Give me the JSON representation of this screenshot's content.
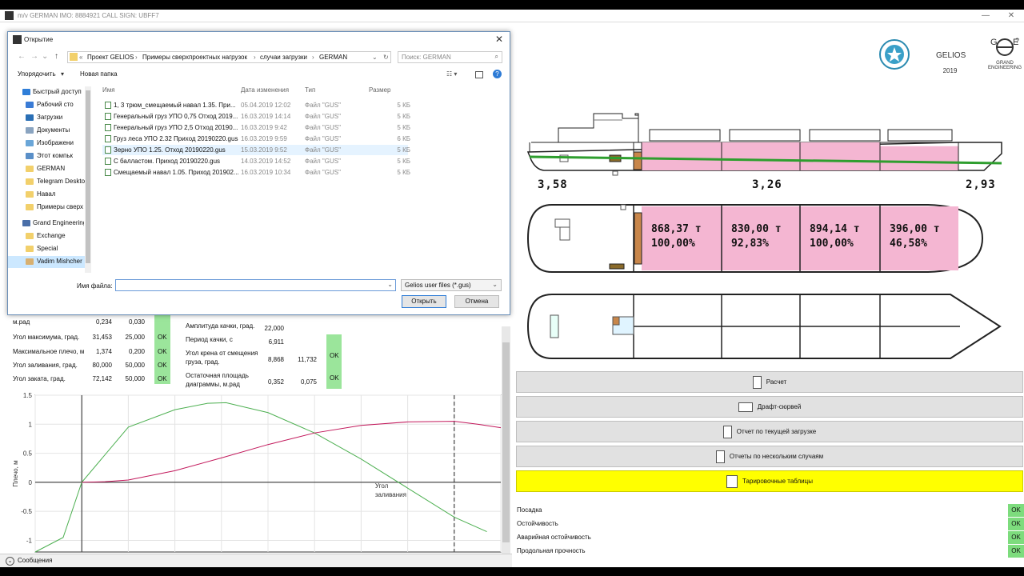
{
  "window": {
    "title": "m/v GERMAN IMO: 8884921 CALL SIGN: UBFF7",
    "help": "?"
  },
  "dialog": {
    "title": "Открытие",
    "breadcrumb": [
      "«",
      "Проект GELIOS",
      "Примеры сверхпроектных нагрузок",
      "случаи загрузки",
      "GERMAN"
    ],
    "search_placeholder": "Поиск: GERMAN",
    "organize": "Упорядочить",
    "new_folder": "Новая папка",
    "nav_items": [
      {
        "label": "Быстрый доступ",
        "top": true,
        "color": "#2f7ed8"
      },
      {
        "label": "Рабочий сто",
        "color": "#3a7bd5"
      },
      {
        "label": "Загрузки",
        "color": "#2a6fb5"
      },
      {
        "label": "Документы",
        "color": "#8aa4c0"
      },
      {
        "label": "Изображени",
        "color": "#6aa6d8"
      },
      {
        "label": "Этот компьк",
        "color": "#5a8fc8"
      },
      {
        "label": "GERMAN",
        "color": "#f2d06b"
      },
      {
        "label": "Telegram Deskto",
        "color": "#f2d06b"
      },
      {
        "label": "Навал",
        "color": "#f2d06b"
      },
      {
        "label": "Примеры сверх",
        "color": "#f2d06b"
      },
      {
        "label": "Grand Engineering",
        "top": true,
        "color": "#4a6fa8"
      },
      {
        "label": "Exchange",
        "color": "#f2d06b"
      },
      {
        "label": "Special",
        "color": "#f2d06b"
      },
      {
        "label": "Vadim Mishcher",
        "color": "#d8b070",
        "selected": true
      }
    ],
    "columns": {
      "name": "Имя",
      "date": "Дата изменения",
      "type": "Тип",
      "size": "Размер"
    },
    "files": [
      {
        "name": "1, 3 трюм_смещаемый навал 1.35. При...",
        "date": "05.04.2019 12:02",
        "type": "Файл \"GUS\"",
        "size": "5 КБ"
      },
      {
        "name": "Генеральный груз УПО 0,75 Отход 2019...",
        "date": "16.03.2019 14:14",
        "type": "Файл \"GUS\"",
        "size": "5 КБ"
      },
      {
        "name": "Генеральный груз УПО 2,5 Отход 20190...",
        "date": "16.03.2019 9:42",
        "type": "Файл \"GUS\"",
        "size": "5 КБ"
      },
      {
        "name": "Груз леса УПО 2.32 Приход 20190220.gus",
        "date": "16.03.2019 9:59",
        "type": "Файл \"GUS\"",
        "size": "6 КБ"
      },
      {
        "name": "Зерно УПО 1.25. Отход 20190220.gus",
        "date": "15.03.2019 9:52",
        "type": "Файл \"GUS\"",
        "size": "5 КБ"
      },
      {
        "name": "С балластом. Приход 20190220.gus",
        "date": "14.03.2019 14:52",
        "type": "Файл \"GUS\"",
        "size": "5 КБ"
      },
      {
        "name": "Смещаемый навал 1.05. Приход 201902...",
        "date": "16.03.2019 10:34",
        "type": "Файл \"GUS\"",
        "size": "5 КБ"
      }
    ],
    "filename_label": "Имя файла:",
    "filename_value": "",
    "filter": "Gelios user files (*.gus)",
    "open": "Открыть",
    "cancel": "Отмена"
  },
  "stability": {
    "rows_left": [
      {
        "label": "м.рад",
        "v1": "0,234",
        "v2": "0,030"
      },
      {
        "label": "Угол максимума, град.",
        "v1": "31,453",
        "v2": "25,000",
        "ok": "OK"
      },
      {
        "label": "Максимальное плечо, м",
        "v1": "1,374",
        "v2": "0,200",
        "ok": "OK"
      },
      {
        "label": "Угол заливания, град.",
        "v1": "80,000",
        "v2": "50,000",
        "ok": "OK"
      },
      {
        "label": "Угол заката, град.",
        "v1": "72,142",
        "v2": "50,000",
        "ok": "OK"
      }
    ],
    "rows_right": [
      {
        "label": "Амплитуда качки, град.",
        "v1": "22,000",
        "v2": ""
      },
      {
        "label": "Период качки, с",
        "v1": "6,911",
        "v2": ""
      },
      {
        "label": "Угол крена от смещения груза, град.",
        "v1": "8,868",
        "v2": "11,732",
        "ok": "OK"
      },
      {
        "label": "Остаточная площадь диаграммы, м.рад",
        "v1": "0,352",
        "v2": "0,075",
        "ok": "OK"
      }
    ]
  },
  "chart_data": {
    "type": "line",
    "ylabel": "Плечо, м",
    "ylim": [
      -1.2,
      1.5
    ],
    "yticks": [
      "1.5",
      "1",
      "0.5",
      "0",
      "-0.5",
      "-1"
    ],
    "xlim": [
      -10,
      90
    ],
    "annotation": "Угол заливания",
    "flood_angle": 80,
    "series": [
      {
        "color": "#4caf50",
        "x": [
          -10,
          -4,
          0,
          10,
          20,
          27,
          31,
          40,
          50,
          60,
          70,
          80,
          87
        ],
        "y": [
          -1.2,
          -0.95,
          0,
          0.95,
          1.25,
          1.36,
          1.37,
          1.2,
          0.85,
          0.4,
          -0.1,
          -0.6,
          -0.85
        ]
      },
      {
        "color": "#c2185b",
        "x": [
          0,
          5,
          10,
          20,
          30,
          40,
          50,
          60,
          70,
          80,
          85,
          90
        ],
        "y": [
          0,
          0.01,
          0.04,
          0.2,
          0.42,
          0.65,
          0.85,
          0.98,
          1.04,
          1.05,
          1.0,
          0.94
        ]
      }
    ]
  },
  "messages": "Сообщения",
  "header": {
    "app": "GELIOS",
    "year": "2019",
    "company": "GRAND ENGINEERING"
  },
  "drafts": {
    "aft": "3,58",
    "mid": "3,26",
    "fwd": "2,93"
  },
  "holds": [
    {
      "weight": "868,37 т",
      "percent": "100,00%",
      "fill": 1.0
    },
    {
      "weight": "830,00 т",
      "percent": "92,83%",
      "fill": 0.9283
    },
    {
      "weight": "894,14 т",
      "percent": "100,00%",
      "fill": 1.0
    },
    {
      "weight": "396,00 т",
      "percent": "46,58%",
      "fill": 0.4658
    }
  ],
  "buttons": {
    "calc": "Расчет",
    "draft_survey": "Драфт-сюрвей",
    "report_current": "Отчет по текущей загрузке",
    "report_multi": "Отчеты по нескольким случаям",
    "tank_tables": "Тарировочные таблицы"
  },
  "status": [
    {
      "label": "Посадка",
      "value": "OK"
    },
    {
      "label": "Остойчивость",
      "value": "OK"
    },
    {
      "label": "Аварийная остойчивость",
      "value": "OK"
    },
    {
      "label": "Продольная прочность",
      "value": "OK"
    }
  ],
  "colors": {
    "cargo": "#f4b6d2",
    "ok": "#7ddc7d",
    "waterline": "#2e9e2e",
    "tank": "#c8864a"
  }
}
